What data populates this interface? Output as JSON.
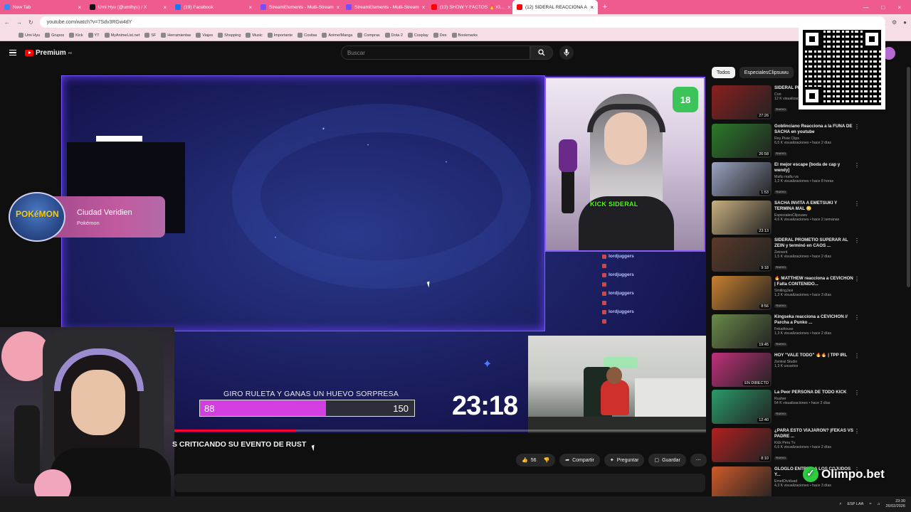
{
  "browser": {
    "tabs": [
      {
        "label": "New Tab",
        "color": "#4285f4"
      },
      {
        "label": "Umi Hyu (@umihyu) / X",
        "color": "#111111"
      },
      {
        "label": "(19) Facebook",
        "color": "#1877f2"
      },
      {
        "label": "StreamElements - Multi-Stream",
        "color": "#7a4cff"
      },
      {
        "label": "StreamElements - Multi-Stream",
        "color": "#7a4cff"
      },
      {
        "label": "(12) SHOW Y FACTOS 🔥 Kl…",
        "color": "#ff0000"
      },
      {
        "label": "(12) SIDERAL REACCIONA A",
        "color": "#ff0000",
        "active": true
      }
    ],
    "url": "youtube.com/watch?v=7Sdv3RGw4dY",
    "bookmarks": [
      "Umi Hyu",
      "Grupos",
      "Kick",
      "YT",
      "MyAnimeList.net",
      "SF",
      "Herramientas",
      "Viajes",
      "Shopping",
      "Music",
      "Importante",
      "Cositas",
      "Anime/Manga",
      "Compras",
      "Dota 2",
      "Cosplay",
      "Des",
      "Bookmarks"
    ]
  },
  "youtube": {
    "logo": "Premium",
    "logo_sup": "PE",
    "search_placeholder": "Buscar"
  },
  "stream": {
    "kick_label": "KICK SIDERAL",
    "badge": "18",
    "chat": [
      "lordjuggers",
      "lordjuggers",
      "lordjuggers",
      "lordjuggers"
    ],
    "overlay_title": "Ciudad Veridien",
    "overlay_sub": "Pokémon",
    "pokemon_logo": "POKéMON",
    "giro": "GIRO RULETA Y GANAS UN HUEVO SORPRESA",
    "bar_value": "88",
    "bar_max": "150",
    "bar_fraction": 0.587,
    "timer": "23:18",
    "progress_fraction": 0.364
  },
  "video": {
    "title_fragment": "S CRITICANDO SU EVENTO DE RUST",
    "likes": "56",
    "share": "Compartir",
    "ask": "Preguntar",
    "save": "Guardar"
  },
  "filters": [
    "Todos",
    "EspecialesClipsuwu"
  ],
  "recommendations": [
    {
      "title": "SIDERAL PI… Dolares ¿Y…",
      "channel": "Cori",
      "meta": "12 K visualizaciones • hace 10 horas",
      "duration": "27:26",
      "thumb": "#8b1f1f",
      "tag": "Nuevo"
    },
    {
      "title": "Goblinciano Reacciona a la FUNA DE SACHA en youtube",
      "channel": "Rey Pixie Clips",
      "meta": "6,5 K visualizaciones • hace 2 días",
      "duration": "26:58",
      "thumb": "#2a7a2a",
      "tag": "Nuevo"
    },
    {
      "title": "El mejor escape [boda de cap y wendy]",
      "channel": "Mafiu mafiu va",
      "meta": "1,2 K visualizaciones • hace 8 horas",
      "duration": "1:53",
      "thumb": "#9aa3c0",
      "tag": "Nuevo"
    },
    {
      "title": "SACHA INVITA A EMETSUKI Y TERMINA MAL 😳",
      "channel": "EspecialesClipsuwu",
      "meta": "4,6 K visualizaciones • hace 2 semanas",
      "duration": "23:13",
      "thumb": "#c8b080",
      "tag": ""
    },
    {
      "title": "SIDERAL PROMETIO SUPERAR AL ZEIN y terminó en CAOS ...",
      "channel": "Zeinwrit",
      "meta": "1,5 K visualizaciones • hace 2 días",
      "duration": "9:18",
      "thumb": "#5a3a2a",
      "tag": "Nuevo"
    },
    {
      "title": "🔥 MATTHEW reacciona a CEVICHON | Falta CONTENIDO...",
      "channel": "SmilingJavi",
      "meta": "1,3 K visualizaciones • hace 3 días",
      "duration": "8:56",
      "thumb": "#c88030",
      "tag": "Nuevo"
    },
    {
      "title": "Kingseka reacciona a CEVICHON // Parcha a Punko ...",
      "channel": "FekaHouse",
      "meta": "1,3 K visualizaciones • hace 2 días",
      "duration": "19:45",
      "thumb": "#6a8a4a",
      "tag": "Nuevo"
    },
    {
      "title": "HOY \"VALE TODO\" 🔥🔥 | TPP IRL",
      "channel": "Zentral Studio",
      "meta": "1,3 K usuarios",
      "duration": "EN DIRECTO",
      "thumb": "#c0307a",
      "tag": ""
    },
    {
      "title": "La Peor PERSONA DE TODO KICK",
      "channel": "Rusher",
      "meta": "54 K visualizaciones • hace 3 días",
      "duration": "12:40",
      "thumb": "#2a9a6a",
      "tag": "Nuevo"
    },
    {
      "title": "¿PARA ESTO VIAJARON? |FEKAS VS PADRE ...",
      "channel": "Kick Peru Tv",
      "meta": "6,6 K visualizaciones • hace 2 días",
      "duration": "8:10",
      "thumb": "#b02020",
      "tag": "Nuevo"
    },
    {
      "title": "GLOGLO ENTRE... A LOS COJUDOS Y...",
      "channel": "EmetDividuad",
      "meta": "4,3 K visualizaciones • hace 3 días",
      "duration": "",
      "thumb": "#d05a2a",
      "tag": ""
    }
  ],
  "sponsor": "Olimpo.bet",
  "taskbar": {
    "lang": "ESP LAA",
    "time": "23:30",
    "date": "26/02/2026"
  }
}
